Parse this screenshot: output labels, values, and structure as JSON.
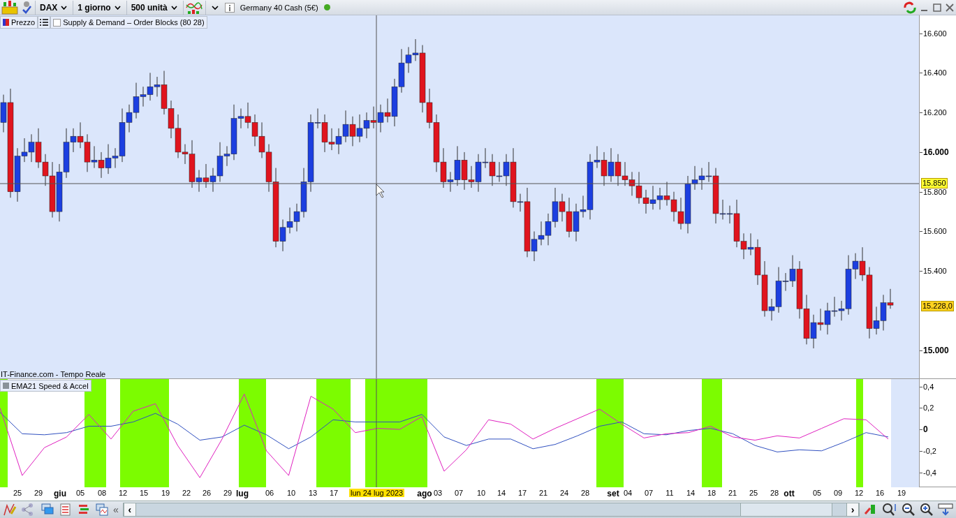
{
  "toolbar": {
    "symbol": "DAX",
    "period": "1 giorno",
    "units": "500 unità",
    "instrument": "Germany 40 Cash (5€)",
    "connected": true
  },
  "legend": {
    "price": "Prezzo",
    "indicator": {
      "label": "Supply & Demand – Order Blocks (80 28)",
      "checked": false
    }
  },
  "price_chart": {
    "source": "IT-Finance.com - Tempo Reale",
    "crosshair_price": "15.850",
    "last_price": "15.228,0",
    "chart_data": {
      "type": "candlestick",
      "ylim": [
        14855,
        16690
      ],
      "yticks": [
        {
          "value": 16600,
          "label": "16.600"
        },
        {
          "value": 16400,
          "label": "16.400"
        },
        {
          "value": 16200,
          "label": "16.200"
        },
        {
          "value": 16000,
          "label": "16.000"
        },
        {
          "value": 15800,
          "label": "15.800"
        },
        {
          "value": 15600,
          "label": "15.600"
        },
        {
          "value": 15400,
          "label": "15.400"
        },
        {
          "value": 15000,
          "label": "15.000"
        }
      ],
      "ohlc": [
        [
          16150,
          16290,
          16100,
          16250
        ],
        [
          16250,
          16320,
          15770,
          15800
        ],
        [
          15800,
          16020,
          15750,
          15980
        ],
        [
          15980,
          16070,
          15950,
          16000
        ],
        [
          16000,
          16090,
          15950,
          16050
        ],
        [
          16050,
          16120,
          15920,
          15950
        ],
        [
          15950,
          15990,
          15830,
          15880
        ],
        [
          15880,
          15950,
          15670,
          15700
        ],
        [
          15700,
          15940,
          15650,
          15900
        ],
        [
          15900,
          16120,
          15870,
          16050
        ],
        [
          16050,
          16120,
          16000,
          16080
        ],
        [
          16080,
          16150,
          16020,
          16050
        ],
        [
          16050,
          16090,
          15900,
          15950
        ],
        [
          15950,
          16030,
          15920,
          15960
        ],
        [
          15960,
          16000,
          15870,
          15920
        ],
        [
          15920,
          16040,
          15890,
          15970
        ],
        [
          15970,
          16020,
          15920,
          15980
        ],
        [
          15980,
          16220,
          15950,
          16150
        ],
        [
          16150,
          16240,
          16100,
          16200
        ],
        [
          16200,
          16350,
          16170,
          16280
        ],
        [
          16280,
          16330,
          16230,
          16290
        ],
        [
          16290,
          16400,
          16260,
          16330
        ],
        [
          16330,
          16380,
          16280,
          16340
        ],
        [
          16340,
          16410,
          16190,
          16220
        ],
        [
          16220,
          16260,
          16070,
          16120
        ],
        [
          16120,
          16190,
          15970,
          16000
        ],
        [
          16000,
          16040,
          15940,
          15990
        ],
        [
          15990,
          16060,
          15820,
          15850
        ],
        [
          15850,
          15910,
          15800,
          15870
        ],
        [
          15870,
          15940,
          15820,
          15850
        ],
        [
          15850,
          15920,
          15800,
          15880
        ],
        [
          15880,
          16050,
          15850,
          15980
        ],
        [
          15980,
          16030,
          15930,
          15990
        ],
        [
          15990,
          16240,
          15960,
          16170
        ],
        [
          16170,
          16220,
          16120,
          16180
        ],
        [
          16180,
          16250,
          16120,
          16150
        ],
        [
          16150,
          16190,
          16030,
          16080
        ],
        [
          16080,
          16150,
          15970,
          16000
        ],
        [
          16000,
          16040,
          15800,
          15850
        ],
        [
          15850,
          15920,
          15520,
          15550
        ],
        [
          15550,
          15660,
          15500,
          15620
        ],
        [
          15620,
          15720,
          15590,
          15650
        ],
        [
          15650,
          15740,
          15600,
          15700
        ],
        [
          15700,
          15920,
          15670,
          15850
        ],
        [
          15850,
          16190,
          15800,
          16150
        ],
        [
          16150,
          16220,
          16120,
          16150
        ],
        [
          16150,
          16190,
          16000,
          16050
        ],
        [
          16050,
          16120,
          16010,
          16040
        ],
        [
          16040,
          16120,
          15990,
          16080
        ],
        [
          16080,
          16210,
          16050,
          16140
        ],
        [
          16140,
          16180,
          16030,
          16080
        ],
        [
          16080,
          16190,
          16050,
          16120
        ],
        [
          16120,
          16200,
          16070,
          16160
        ],
        [
          16160,
          16230,
          16120,
          16150
        ],
        [
          16150,
          16240,
          16100,
          16200
        ],
        [
          16200,
          16270,
          16150,
          16180
        ],
        [
          16180,
          16370,
          16130,
          16330
        ],
        [
          16330,
          16520,
          16300,
          16450
        ],
        [
          16450,
          16530,
          16400,
          16490
        ],
        [
          16490,
          16570,
          16460,
          16500
        ],
        [
          16500,
          16540,
          16200,
          16250
        ],
        [
          16250,
          16320,
          16120,
          16150
        ],
        [
          16150,
          16190,
          15900,
          15950
        ],
        [
          15950,
          16020,
          15820,
          15850
        ],
        [
          15850,
          15900,
          15800,
          15860
        ],
        [
          15860,
          16030,
          15830,
          15960
        ],
        [
          15960,
          16000,
          15810,
          15860
        ],
        [
          15860,
          15930,
          15820,
          15850
        ],
        [
          15850,
          15990,
          15800,
          15950
        ],
        [
          15950,
          16020,
          15920,
          15950
        ],
        [
          15950,
          15990,
          15830,
          15880
        ],
        [
          15880,
          15950,
          15850,
          15880
        ],
        [
          15880,
          15990,
          15830,
          15950
        ],
        [
          15950,
          16020,
          15720,
          15750
        ],
        [
          15750,
          15790,
          15700,
          15750
        ],
        [
          15750,
          15820,
          15470,
          15500
        ],
        [
          15500,
          15600,
          15450,
          15560
        ],
        [
          15560,
          15650,
          15530,
          15580
        ],
        [
          15580,
          15690,
          15530,
          15650
        ],
        [
          15650,
          15820,
          15620,
          15750
        ],
        [
          15750,
          15790,
          15650,
          15700
        ],
        [
          15700,
          15770,
          15570,
          15600
        ],
        [
          15600,
          15740,
          15550,
          15700
        ],
        [
          15700,
          15780,
          15670,
          15710
        ],
        [
          15710,
          15990,
          15660,
          15950
        ],
        [
          15950,
          16030,
          15920,
          15960
        ],
        [
          15960,
          16000,
          15830,
          15880
        ],
        [
          15880,
          16020,
          15850,
          15950
        ],
        [
          15950,
          15990,
          15830,
          15880
        ],
        [
          15880,
          15950,
          15830,
          15860
        ],
        [
          15860,
          15900,
          15780,
          15830
        ],
        [
          15830,
          15900,
          15740,
          15770
        ],
        [
          15770,
          15810,
          15690,
          15740
        ],
        [
          15740,
          15830,
          15710,
          15760
        ],
        [
          15760,
          15820,
          15710,
          15780
        ],
        [
          15780,
          15850,
          15730,
          15760
        ],
        [
          15760,
          15800,
          15650,
          15700
        ],
        [
          15700,
          15770,
          15610,
          15640
        ],
        [
          15640,
          15880,
          15590,
          15840
        ],
        [
          15840,
          15930,
          15810,
          15860
        ],
        [
          15860,
          15920,
          15810,
          15880
        ],
        [
          15880,
          15950,
          15850,
          15880
        ],
        [
          15880,
          15920,
          15640,
          15690
        ],
        [
          15690,
          15760,
          15660,
          15690
        ],
        [
          15690,
          15730,
          15640,
          15690
        ],
        [
          15690,
          15760,
          15520,
          15550
        ],
        [
          15550,
          15590,
          15460,
          15510
        ],
        [
          15510,
          15590,
          15480,
          15520
        ],
        [
          15520,
          15560,
          15330,
          15380
        ],
        [
          15380,
          15450,
          15170,
          15200
        ],
        [
          15200,
          15260,
          15150,
          15220
        ],
        [
          15220,
          15420,
          15190,
          15350
        ],
        [
          15350,
          15390,
          15300,
          15350
        ],
        [
          15350,
          15480,
          15320,
          15410
        ],
        [
          15410,
          15450,
          15160,
          15210
        ],
        [
          15210,
          15280,
          15030,
          15060
        ],
        [
          15060,
          15180,
          15010,
          15140
        ],
        [
          15140,
          15210,
          15100,
          15130
        ],
        [
          15130,
          15240,
          15080,
          15200
        ],
        [
          15200,
          15270,
          15170,
          15200
        ],
        [
          15200,
          15250,
          15150,
          15210
        ],
        [
          15210,
          15480,
          15180,
          15410
        ],
        [
          15410,
          15490,
          15360,
          15450
        ],
        [
          15450,
          15520,
          15350,
          15380
        ],
        [
          15380,
          15420,
          15060,
          15110
        ],
        [
          15110,
          15220,
          15080,
          15150
        ],
        [
          15150,
          15280,
          15100,
          15240
        ],
        [
          15240,
          15310,
          15210,
          15228
        ]
      ]
    }
  },
  "indicator_panel": {
    "title": "EMA21 Speed & Accel",
    "chart_data": {
      "type": "line",
      "ylim": [
        -0.54,
        0.47
      ],
      "yticks": [
        {
          "value": 0.4,
          "label": "0,4"
        },
        {
          "value": 0.2,
          "label": "0,2"
        },
        {
          "value": 0,
          "label": "0"
        },
        {
          "value": -0.2,
          "label": "-0,2"
        },
        {
          "value": -0.4,
          "label": "-0,4"
        }
      ],
      "series": [
        {
          "color": "#3050c0",
          "values": [
            0.16,
            -0.04,
            -0.05,
            -0.03,
            0.03,
            0.03,
            0.07,
            0.15,
            0.05,
            -0.1,
            -0.07,
            0.04,
            -0.05,
            -0.18,
            -0.07,
            0.09,
            0.07,
            0.07,
            0.07,
            0.14,
            -0.07,
            -0.15,
            -0.09,
            -0.09,
            -0.18,
            -0.14,
            -0.06,
            0.03,
            0.07,
            -0.04,
            -0.05,
            -0.01,
            0.01,
            -0.04,
            -0.15,
            -0.21,
            -0.19,
            -0.2,
            -0.12,
            -0.03,
            -0.07
          ]
        },
        {
          "color": "#e020c0",
          "values": [
            0.2,
            -0.43,
            -0.17,
            -0.07,
            0.14,
            -0.09,
            0.17,
            0.24,
            -0.15,
            -0.45,
            -0.09,
            0.33,
            -0.2,
            -0.43,
            0.31,
            0.19,
            -0.03,
            0.01,
            0,
            0.12,
            -0.39,
            -0.19,
            0.09,
            0.05,
            -0.09,
            0.01,
            0.1,
            0.19,
            0.05,
            -0.08,
            -0.04,
            -0.03,
            0.03,
            -0.07,
            -0.1,
            -0.06,
            -0.08,
            0.01,
            0.1,
            0.09,
            -0.09
          ]
        }
      ]
    }
  },
  "x_axis": {
    "crosshair_date": "lun 24 lug 2023",
    "labels": [
      {
        "label": "25",
        "kind": "day"
      },
      {
        "label": "29",
        "kind": "day"
      },
      {
        "label": "giu",
        "kind": "month"
      },
      {
        "label": "05",
        "kind": "day"
      },
      {
        "label": "08",
        "kind": "day"
      },
      {
        "label": "12",
        "kind": "day"
      },
      {
        "label": "15",
        "kind": "day"
      },
      {
        "label": "19",
        "kind": "day"
      },
      {
        "label": "22",
        "kind": "day"
      },
      {
        "label": "26",
        "kind": "day"
      },
      {
        "label": "29",
        "kind": "day"
      },
      {
        "label": "lug",
        "kind": "month"
      },
      {
        "label": "06",
        "kind": "day"
      },
      {
        "label": "10",
        "kind": "day"
      },
      {
        "label": "13",
        "kind": "day"
      },
      {
        "label": "17",
        "kind": "day"
      },
      {
        "label": "ago",
        "kind": "month"
      },
      {
        "label": "03",
        "kind": "day"
      },
      {
        "label": "07",
        "kind": "day"
      },
      {
        "label": "10",
        "kind": "day"
      },
      {
        "label": "14",
        "kind": "day"
      },
      {
        "label": "17",
        "kind": "day"
      },
      {
        "label": "21",
        "kind": "day"
      },
      {
        "label": "24",
        "kind": "day"
      },
      {
        "label": "28",
        "kind": "day"
      },
      {
        "label": "set",
        "kind": "month"
      },
      {
        "label": "04",
        "kind": "day"
      },
      {
        "label": "07",
        "kind": "day"
      },
      {
        "label": "11",
        "kind": "day"
      },
      {
        "label": "14",
        "kind": "day"
      },
      {
        "label": "18",
        "kind": "day"
      },
      {
        "label": "21",
        "kind": "day"
      },
      {
        "label": "25",
        "kind": "day"
      },
      {
        "label": "28",
        "kind": "day"
      },
      {
        "label": "ott",
        "kind": "month"
      },
      {
        "label": "05",
        "kind": "day"
      },
      {
        "label": "09",
        "kind": "day"
      },
      {
        "label": "12",
        "kind": "day"
      },
      {
        "label": "16",
        "kind": "day"
      },
      {
        "label": "19",
        "kind": "day"
      }
    ]
  },
  "bottom_bar": {
    "collapse": "«",
    "scroll_left": "‹",
    "scroll_right": "›"
  }
}
